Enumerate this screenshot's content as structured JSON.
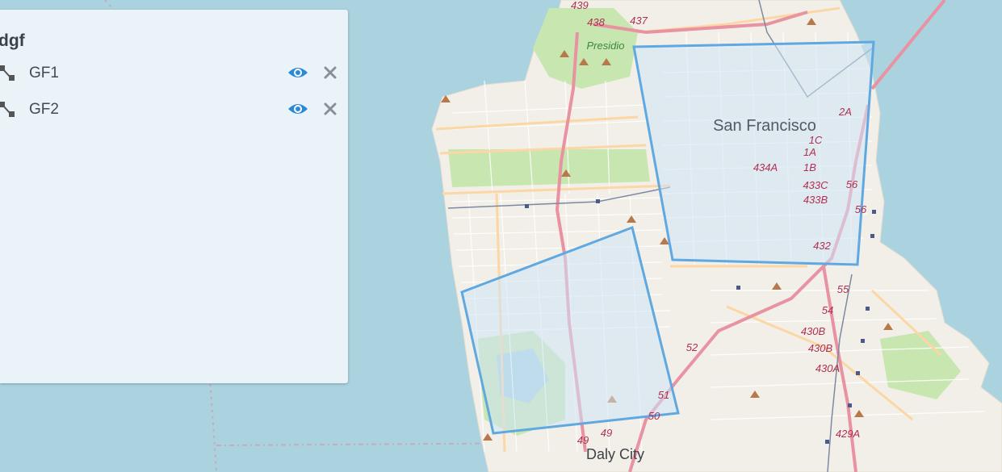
{
  "panel": {
    "title": "dgf",
    "geofences": [
      {
        "name": "GF1",
        "visible": true
      },
      {
        "name": "GF2",
        "visible": true
      }
    ]
  },
  "map": {
    "labels": {
      "city": "San Francisco",
      "daly_city": "Daly City",
      "presidio": "Presidio"
    },
    "route_shields": [
      "439",
      "438",
      "437",
      "2A",
      "1C",
      "1A",
      "1B",
      "434A",
      "433C",
      "433B",
      "56",
      "56",
      "432",
      "55",
      "54",
      "430B",
      "430B",
      "430A",
      "52",
      "51",
      "50",
      "49",
      "49",
      "429A"
    ],
    "colors": {
      "water": "#aad3df",
      "land": "#f2efe9",
      "park": "#c8e6b0",
      "major_road": "#e892a2",
      "secondary_road": "#fcd6a4",
      "geofence_stroke": "#5fa8e0",
      "geofence_fill": "#cfe3f5",
      "eye_icon": "#2b8ad6",
      "close_icon": "#8a8f95"
    }
  },
  "icons": {
    "geofence_type": "polygon-icon",
    "toggle_visibility": "eye-icon",
    "remove": "close-icon"
  }
}
